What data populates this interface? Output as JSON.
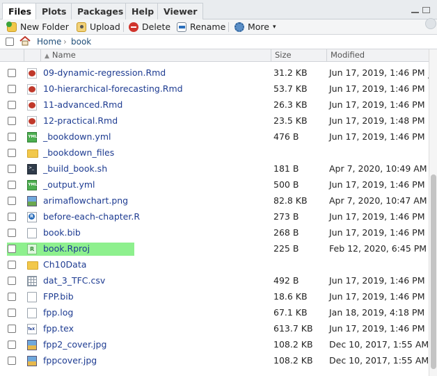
{
  "tabs": [
    {
      "label": "Files",
      "active": true
    },
    {
      "label": "Plots",
      "active": false
    },
    {
      "label": "Packages",
      "active": false
    },
    {
      "label": "Help",
      "active": false
    },
    {
      "label": "Viewer",
      "active": false
    }
  ],
  "toolbar": {
    "new_folder": "New Folder",
    "upload": "Upload",
    "delete": "Delete",
    "rename": "Rename",
    "more": "More",
    "more_chevron": "▾"
  },
  "breadcrumb": {
    "home": "Home",
    "separator": "›",
    "folder": "book",
    "overflow": "..."
  },
  "columns": {
    "sort_indicator": "▲",
    "name": "Name",
    "size": "Size",
    "modified": "Modified"
  },
  "rows": [
    {
      "name": "09-dynamic-regression.Rmd",
      "size": "31.2 KB",
      "modified": "Jun 17, 2019, 1:46 PM",
      "icon": "rmd-file-icon",
      "selected": false
    },
    {
      "name": "10-hierarchical-forecasting.Rmd",
      "size": "53.7 KB",
      "modified": "Jun 17, 2019, 1:46 PM",
      "icon": "rmd-file-icon",
      "selected": false
    },
    {
      "name": "11-advanced.Rmd",
      "size": "26.3 KB",
      "modified": "Jun 17, 2019, 1:46 PM",
      "icon": "rmd-file-icon",
      "selected": false
    },
    {
      "name": "12-practical.Rmd",
      "size": "23.5 KB",
      "modified": "Jun 17, 2019, 1:48 PM",
      "icon": "rmd-file-icon",
      "selected": false
    },
    {
      "name": "_bookdown.yml",
      "size": "476 B",
      "modified": "Jun 17, 2019, 1:46 PM",
      "icon": "yml-file-icon",
      "selected": false
    },
    {
      "name": "_bookdown_files",
      "size": "",
      "modified": "",
      "icon": "folder-icon",
      "selected": false
    },
    {
      "name": "_build_book.sh",
      "size": "181 B",
      "modified": "Apr 7, 2020, 10:49 AM",
      "icon": "shell-script-icon",
      "selected": false
    },
    {
      "name": "_output.yml",
      "size": "500 B",
      "modified": "Jun 17, 2019, 1:46 PM",
      "icon": "yml-file-icon",
      "selected": false
    },
    {
      "name": "arimaflowchart.png",
      "size": "82.8 KB",
      "modified": "Apr 7, 2020, 10:47 AM",
      "icon": "image-file-icon",
      "selected": false
    },
    {
      "name": "before-each-chapter.R",
      "size": "273 B",
      "modified": "Jun 17, 2019, 1:46 PM",
      "icon": "r-script-icon",
      "selected": false
    },
    {
      "name": "book.bib",
      "size": "268 B",
      "modified": "Jun 17, 2019, 1:46 PM",
      "icon": "text-file-icon",
      "selected": false
    },
    {
      "name": "book.Rproj",
      "size": "225 B",
      "modified": "Feb 12, 2020, 6:45 PM",
      "icon": "rproj-file-icon",
      "selected": true
    },
    {
      "name": "Ch10Data",
      "size": "",
      "modified": "",
      "icon": "folder-icon",
      "selected": false
    },
    {
      "name": "dat_3_TFC.csv",
      "size": "492 B",
      "modified": "Jun 17, 2019, 1:46 PM",
      "icon": "csv-file-icon",
      "selected": false
    },
    {
      "name": "FPP.bib",
      "size": "18.6 KB",
      "modified": "Jun 17, 2019, 1:46 PM",
      "icon": "text-file-icon",
      "selected": false
    },
    {
      "name": "fpp.log",
      "size": "67.1 KB",
      "modified": "Jan 18, 2019, 4:18 PM",
      "icon": "text-file-icon",
      "selected": false
    },
    {
      "name": "fpp.tex",
      "size": "613.7 KB",
      "modified": "Jun 17, 2019, 1:46 PM",
      "icon": "tex-file-icon",
      "selected": false
    },
    {
      "name": "fpp2_cover.jpg",
      "size": "108.2 KB",
      "modified": "Dec 10, 2017, 1:55 AM",
      "icon": "image-file-icon",
      "selected": false
    },
    {
      "name": "fppcover.jpg",
      "size": "108.2 KB",
      "modified": "Dec 10, 2017, 1:55 AM",
      "icon": "image-file-icon",
      "selected": false
    }
  ],
  "colors": {
    "link": "#1d3b91",
    "highlight": "#8ef08e",
    "tabbar_bg": "#e9ecef"
  }
}
